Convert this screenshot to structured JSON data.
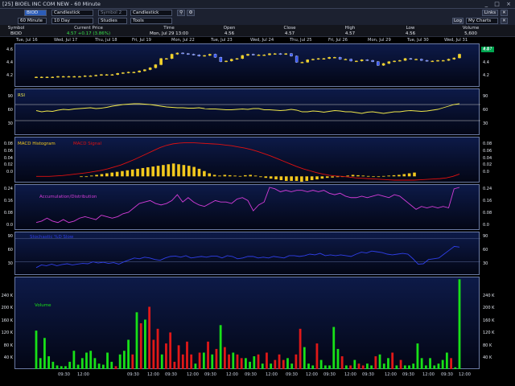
{
  "window": {
    "title": "[25] BIOEL INC COM NEW - 60 Minute",
    "controls": "_ □ ×"
  },
  "toolbar": {
    "row1": {
      "symbol": "BIOD",
      "chart_type": "Candlestick",
      "symbol2_placeholder": "Symbol 2",
      "chart_type2": "Candlestick",
      "pin_icon": "⚲",
      "tools_icon": "⚙",
      "links": "Links",
      "close": "✕"
    },
    "row2": {
      "interval": "60 Minute",
      "period": "10 Day",
      "studies": "Studies",
      "tools": "Tools",
      "log": "Log",
      "my_charts": "My Charts",
      "close": "✕"
    }
  },
  "quote": {
    "headers": [
      "Symbol",
      "Current Price",
      "Time",
      "Open",
      "Close",
      "High",
      "Low",
      "Volume"
    ],
    "values": [
      "BIOD",
      "4.57 +0.17 (3.86%)",
      "Mon, Jul 29 13:00",
      "4.56",
      "4.57",
      "4.57",
      "4.56",
      "5,600"
    ]
  },
  "dates_top": [
    "Tue, Jul 16",
    "Wed, Jul 17",
    "Thu, Jul 18",
    "Fri, Jul 19",
    "Mon, Jul 22",
    "Tue, Jul 23",
    "Wed, Jul 24",
    "Thu, Jul 25",
    "Fri, Jul 26",
    "Mon, Jul 29",
    "Tue, Jul 30",
    "Wed, Jul 31"
  ],
  "last_price_badge": "4.57",
  "panels": {
    "price": {
      "left_ticks": [
        "4.6",
        "4.4",
        "4.2"
      ],
      "right_ticks": [
        "4.6",
        "4.4",
        "4.2"
      ]
    },
    "rsi": {
      "title": "RSI",
      "ticks": [
        "90",
        "60",
        "30"
      ]
    },
    "macd": {
      "title_hist": "MACD Histogram",
      "title_signal": "MACD Signal",
      "ticks": [
        "0.08",
        "0.06",
        "0.04",
        "0.02",
        "0.0"
      ]
    },
    "ad": {
      "title": "Accumulation/Distribution",
      "ticks": [
        "0.24",
        "0.16",
        "0.08",
        "0.0"
      ]
    },
    "stoch": {
      "title": "Stochastic %D Slow",
      "ticks": [
        "90",
        "60",
        "30"
      ]
    },
    "volume": {
      "title": "Volume",
      "ticks": [
        "240 K",
        "200 K",
        "160 K",
        "120 K",
        "80 K",
        "40 K"
      ]
    }
  },
  "time_axis": [
    "09:30",
    "12:00",
    "09:30",
    "12:00",
    "09:30",
    "12:00",
    "09:30",
    "12:00",
    "09:30",
    "12:00",
    "09:30",
    "12:00",
    "09:30",
    "12:00",
    "09:30",
    "12:00",
    "09:30",
    "12:00",
    "09:30",
    "12:00",
    "12:00",
    "12:00"
  ],
  "colors": {
    "up": "#f2d22a",
    "down": "#3b5bff",
    "rsi": "#f0e84a",
    "macd_hist": "#f2c81e",
    "macd_signal": "#e01010",
    "ad": "#d43cd8",
    "stoch": "#2f3fe8",
    "vol_up": "#18e018",
    "vol_down": "#e01818",
    "grid": "#c8c8c8"
  },
  "chart_data": {
    "type": "candlestick",
    "price": {
      "ylim": [
        4.08,
        4.68
      ],
      "opens": [
        4.2,
        4.2,
        4.2,
        4.2,
        4.2,
        4.21,
        4.21,
        4.21,
        4.21,
        4.21,
        4.22,
        4.22,
        4.23,
        4.24,
        4.24,
        4.24,
        4.26,
        4.27,
        4.28,
        4.28,
        4.3,
        4.32,
        4.35,
        4.4,
        4.5,
        4.5,
        4.57,
        4.59,
        4.58,
        4.57,
        4.56,
        4.54,
        4.55,
        4.57,
        4.52,
        4.45,
        4.46,
        4.49,
        4.5,
        4.55,
        4.57,
        4.56,
        4.56,
        4.56,
        4.58,
        4.58,
        4.57,
        4.58,
        4.54,
        4.44,
        4.44,
        4.48,
        4.49,
        4.5,
        4.5,
        4.52,
        4.52,
        4.49,
        4.49,
        4.46,
        4.46,
        4.48,
        4.47,
        4.45,
        4.39,
        4.42,
        4.45,
        4.46,
        4.47,
        4.5,
        4.49,
        4.49,
        4.47,
        4.46,
        4.46,
        4.47,
        4.47,
        4.49,
        4.51
      ],
      "closes": [
        4.2,
        4.2,
        4.2,
        4.2,
        4.21,
        4.21,
        4.21,
        4.21,
        4.21,
        4.22,
        4.22,
        4.23,
        4.24,
        4.24,
        4.24,
        4.26,
        4.27,
        4.28,
        4.28,
        4.3,
        4.32,
        4.35,
        4.4,
        4.5,
        4.5,
        4.57,
        4.59,
        4.58,
        4.57,
        4.56,
        4.54,
        4.55,
        4.57,
        4.52,
        4.45,
        4.46,
        4.49,
        4.5,
        4.55,
        4.57,
        4.56,
        4.56,
        4.56,
        4.58,
        4.58,
        4.57,
        4.58,
        4.54,
        4.44,
        4.44,
        4.48,
        4.49,
        4.5,
        4.5,
        4.52,
        4.52,
        4.49,
        4.49,
        4.46,
        4.46,
        4.48,
        4.47,
        4.45,
        4.39,
        4.42,
        4.45,
        4.46,
        4.47,
        4.5,
        4.49,
        4.49,
        4.47,
        4.46,
        4.46,
        4.47,
        4.47,
        4.49,
        4.51,
        4.57
      ]
    },
    "rsi": {
      "ylim": [
        0,
        100
      ],
      "levels": [
        70,
        30
      ],
      "values": [
        55,
        52,
        54,
        53,
        56,
        58,
        57,
        59,
        60,
        61,
        62,
        60,
        61,
        63,
        66,
        68,
        70,
        71,
        72,
        72,
        71,
        70,
        68,
        66,
        64,
        63,
        62,
        62,
        61,
        61,
        62,
        60,
        59,
        59,
        58,
        57,
        57,
        58,
        59,
        58,
        60,
        60,
        57,
        57,
        56,
        55,
        56,
        58,
        56,
        52,
        52,
        54,
        53,
        51,
        53,
        55,
        54,
        52,
        52,
        50,
        48,
        51,
        52,
        50,
        48,
        50,
        52,
        52,
        54,
        55,
        54,
        53,
        54,
        56,
        58,
        62,
        66,
        70,
        72
      ]
    },
    "macd": {
      "ylim": [
        -0.01,
        0.09
      ],
      "hist": [
        0.0,
        0.0,
        0.002,
        0.004,
        0.006,
        0.008,
        0.01,
        0.012,
        0.014,
        0.016,
        0.018,
        0.02,
        0.022,
        0.024,
        0.026,
        0.028,
        0.03,
        0.032,
        0.034,
        0.032,
        0.03,
        0.028,
        0.025,
        0.02,
        0.014,
        0.008,
        0.004,
        0.002,
        0.004,
        0.003,
        0.002,
        0.001,
        0.003,
        0.004,
        0.002,
        -0.002,
        -0.004,
        -0.006,
        -0.008,
        -0.01,
        -0.012,
        -0.012,
        -0.012,
        -0.014,
        -0.012,
        -0.01,
        -0.008,
        -0.006,
        -0.004,
        -0.003,
        -0.002,
        0.0,
        0.002,
        0.004,
        0.003,
        0.002,
        0.001,
        0.0,
        0.0,
        0.001,
        0.002,
        0.003,
        0.004,
        0.006,
        0.008,
        0.01
      ],
      "signal": [
        0.0,
        0.0,
        0.0,
        0.001,
        0.002,
        0.004,
        0.006,
        0.008,
        0.01,
        0.013,
        0.016,
        0.02,
        0.025,
        0.03,
        0.037,
        0.044,
        0.052,
        0.06,
        0.068,
        0.076,
        0.082,
        0.086,
        0.088,
        0.089,
        0.089,
        0.088,
        0.087,
        0.086,
        0.085,
        0.083,
        0.081,
        0.078,
        0.075,
        0.071,
        0.066,
        0.06,
        0.054,
        0.047,
        0.04,
        0.033,
        0.026,
        0.02,
        0.015,
        0.01,
        0.006,
        0.003,
        0.001,
        0.0,
        -0.002,
        -0.004,
        -0.005,
        -0.006,
        -0.007,
        -0.008,
        -0.009,
        -0.01,
        -0.01,
        -0.01,
        -0.01,
        -0.009,
        -0.008,
        -0.007,
        -0.006,
        -0.004,
        0.0,
        0.006
      ]
    },
    "ad": {
      "ylim": [
        -0.02,
        0.26
      ],
      "values": [
        0.02,
        0.03,
        0.05,
        0.03,
        0.02,
        0.04,
        0.02,
        0.03,
        0.05,
        0.06,
        0.05,
        0.04,
        0.07,
        0.06,
        0.05,
        0.06,
        0.08,
        0.09,
        0.12,
        0.15,
        0.16,
        0.17,
        0.15,
        0.14,
        0.15,
        0.17,
        0.21,
        0.16,
        0.19,
        0.16,
        0.14,
        0.13,
        0.15,
        0.17,
        0.16,
        0.16,
        0.15,
        0.18,
        0.19,
        0.17,
        0.1,
        0.14,
        0.16,
        0.26,
        0.25,
        0.23,
        0.24,
        0.23,
        0.24,
        0.24,
        0.23,
        0.24,
        0.23,
        0.24,
        0.22,
        0.21,
        0.22,
        0.2,
        0.19,
        0.19,
        0.2,
        0.19,
        0.2,
        0.21,
        0.2,
        0.19,
        0.21,
        0.2,
        0.17,
        0.14,
        0.11,
        0.13,
        0.12,
        0.13,
        0.12,
        0.13,
        0.12,
        0.25,
        0.26
      ]
    },
    "stoch": {
      "ylim": [
        0,
        100
      ],
      "values": [
        15,
        22,
        20,
        24,
        20,
        23,
        25,
        22,
        24,
        26,
        25,
        30,
        27,
        29,
        26,
        28,
        24,
        30,
        35,
        40,
        38,
        42,
        40,
        36,
        34,
        40,
        44,
        45,
        42,
        46,
        40,
        42,
        44,
        42,
        45,
        45,
        40,
        46,
        44,
        38,
        40,
        44,
        44,
        40,
        42,
        40,
        44,
        42,
        40,
        46,
        46,
        44,
        46,
        50,
        48,
        52,
        46,
        48,
        46,
        48,
        46,
        44,
        50,
        55,
        53,
        58,
        56,
        54,
        50,
        48,
        50,
        52,
        50,
        38,
        24,
        25,
        36,
        38,
        40,
        50,
        60,
        70,
        68
      ]
    },
    "volume": {
      "ylim": [
        0,
        250000
      ],
      "values": [
        105000,
        30000,
        85000,
        35000,
        20000,
        10000,
        8000,
        8000,
        20000,
        50000,
        12000,
        30000,
        45000,
        50000,
        30000,
        15000,
        12000,
        45000,
        20000,
        8000,
        40000,
        50000,
        80000,
        40000,
        155000,
        125000,
        135000,
        170000,
        80000,
        110000,
        40000,
        70000,
        100000,
        20000,
        65000,
        40000,
        75000,
        40000,
        15000,
        45000,
        45000,
        75000,
        40000,
        55000,
        120000,
        60000,
        40000,
        45000,
        40000,
        30000,
        30000,
        20000,
        35000,
        40000,
        15000,
        45000,
        15000,
        25000,
        40000,
        25000,
        30000,
        15000,
        40000,
        110000,
        60000,
        15000,
        10000,
        70000,
        25000,
        10000,
        10000,
        115000,
        55000,
        35000,
        10000,
        10000,
        25000,
        15000,
        10000,
        15000,
        10000,
        35000,
        40000,
        15000,
        30000,
        45000,
        10000,
        25000,
        10000,
        10000,
        15000,
        70000,
        30000,
        10000,
        30000,
        10000,
        15000,
        25000,
        45000,
        30000,
        5000,
        245000
      ],
      "up": [
        1,
        1,
        1,
        1,
        1,
        1,
        1,
        1,
        1,
        1,
        1,
        1,
        1,
        1,
        1,
        1,
        1,
        1,
        1,
        0,
        1,
        1,
        1,
        0,
        1,
        0,
        1,
        0,
        0,
        0,
        1,
        0,
        0,
        0,
        0,
        0,
        0,
        0,
        1,
        0,
        1,
        0,
        1,
        0,
        1,
        0,
        0,
        1,
        0,
        0,
        1,
        1,
        1,
        0,
        1,
        0,
        1,
        0,
        0,
        0,
        1,
        1,
        0,
        0,
        1,
        1,
        1,
        0,
        1,
        1,
        1,
        1,
        1,
        0,
        1,
        0,
        1,
        0,
        0,
        1,
        1,
        0,
        1,
        1,
        1,
        0,
        1,
        0,
        1,
        1,
        1,
        1,
        1,
        1,
        1,
        1,
        1,
        1,
        1,
        0,
        1,
        1
      ]
    }
  }
}
